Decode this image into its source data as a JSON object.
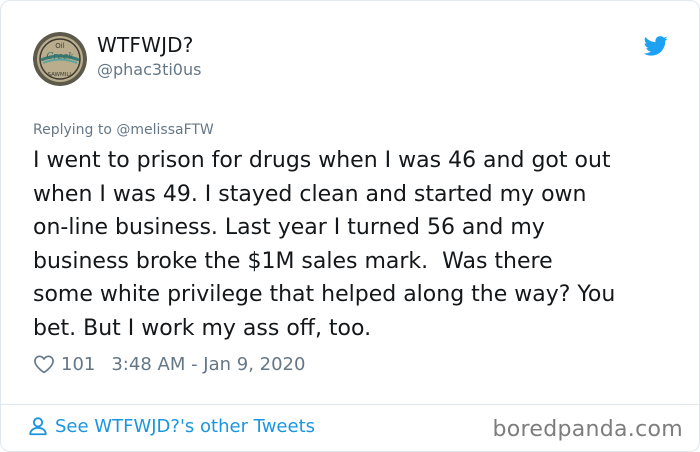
{
  "author": {
    "display_name": "WTFWJD?",
    "handle": "@phac3ti0us",
    "avatar_text": [
      "Oil",
      "Creek",
      "SAWMILL"
    ]
  },
  "replying_to": "Replying to @melissaFTW",
  "tweet": {
    "text": "I went to prison for drugs when I was 46 and got out\nwhen I was 49. I stayed clean and started my own\non-line business. Last year I turned 56 and my\nbusiness broke the $1M sales mark.  Was there\nsome white privilege that helped along the way? You\nbet. But I work my ass off, too."
  },
  "meta": {
    "likes": "101",
    "timestamp": "3:48 AM - Jan 9, 2020"
  },
  "footer": {
    "see_more_label": "See WTFWJD?'s other Tweets"
  },
  "watermark": "boredpanda.com",
  "colors": {
    "link": "#1b95e0",
    "twitter_blue": "#1da1f2",
    "secondary_text": "#657786",
    "border": "#e1e8ed"
  },
  "icons": {
    "brand": "twitter-bird-icon",
    "like": "heart-icon",
    "profile": "person-icon"
  }
}
